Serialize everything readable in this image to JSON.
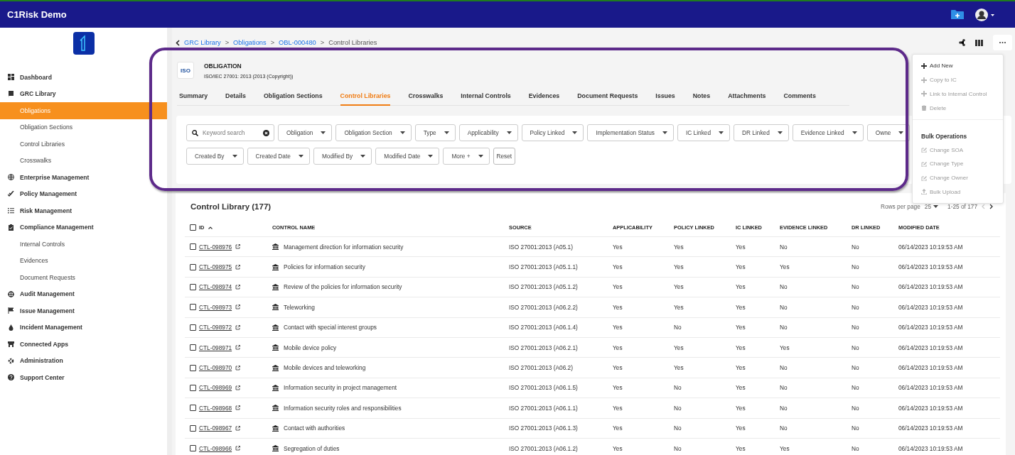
{
  "top_bar": {
    "title": "C1Risk Demo"
  },
  "sidebar": {
    "items": [
      {
        "kind": "section",
        "label": "Dashboard",
        "selected": false
      },
      {
        "kind": "section",
        "label": "GRC Library",
        "selected": false
      },
      {
        "kind": "sub",
        "label": "Obligations",
        "selected": true
      },
      {
        "kind": "sub",
        "label": "Obligation Sections",
        "selected": false
      },
      {
        "kind": "sub",
        "label": "Control Libraries",
        "selected": false
      },
      {
        "kind": "sub",
        "label": "Crosswalks",
        "selected": false
      },
      {
        "kind": "section",
        "label": "Enterprise Management",
        "selected": false
      },
      {
        "kind": "section",
        "label": "Policy Management",
        "selected": false
      },
      {
        "kind": "section",
        "label": "Risk Management",
        "selected": false
      },
      {
        "kind": "section",
        "label": "Compliance Management",
        "selected": false
      },
      {
        "kind": "sub",
        "label": "Internal Controls",
        "selected": false
      },
      {
        "kind": "sub",
        "label": "Evidences",
        "selected": false
      },
      {
        "kind": "sub",
        "label": "Document Requests",
        "selected": false
      },
      {
        "kind": "section",
        "label": "Audit Management",
        "selected": false
      },
      {
        "kind": "section",
        "label": "Issue Management",
        "selected": false
      },
      {
        "kind": "section",
        "label": "Incident Management",
        "selected": false
      },
      {
        "kind": "section",
        "label": "Connected Apps",
        "selected": false
      },
      {
        "kind": "section",
        "label": "Administration",
        "selected": false
      },
      {
        "kind": "section",
        "label": "Support Center",
        "selected": false
      }
    ]
  },
  "breadcrumb": {
    "separator": ">",
    "items": [
      "GRC Library",
      "Obligations",
      "OBL-000480"
    ],
    "current": "Control Libraries"
  },
  "header": {
    "logo": "ISO",
    "title": "OBLIGATION",
    "subtitle": "ISO/IEC 27001: 2013 (2013 (Copyright))"
  },
  "tabs": [
    {
      "label": "Summary",
      "selected": false
    },
    {
      "label": "Details",
      "selected": false
    },
    {
      "label": "Obligation Sections",
      "selected": false
    },
    {
      "label": "Control Libraries",
      "selected": true
    },
    {
      "label": "Crosswalks",
      "selected": false
    },
    {
      "label": "Internal Controls",
      "selected": false
    },
    {
      "label": "Evidences",
      "selected": false
    },
    {
      "label": "Document Requests",
      "selected": false
    },
    {
      "label": "Issues",
      "selected": false
    },
    {
      "label": "Notes",
      "selected": false
    },
    {
      "label": "Attachments",
      "selected": false
    },
    {
      "label": "Comments",
      "selected": false
    }
  ],
  "filters": [
    [
      {
        "kind": "search",
        "placeholder": "Keyword search"
      },
      {
        "kind": "dropdown",
        "label": "Obligation"
      },
      {
        "kind": "dropdown",
        "label": "Obligation Section"
      },
      {
        "kind": "dropdown",
        "label": "Type"
      },
      {
        "kind": "dropdown",
        "label": "Applicability"
      },
      {
        "kind": "dropdown",
        "label": "Policy Linked"
      },
      {
        "kind": "dropdown",
        "label": "Implementation Status"
      },
      {
        "kind": "dropdown",
        "label": "IC Linked"
      },
      {
        "kind": "dropdown",
        "label": "DR Linked"
      },
      {
        "kind": "dropdown",
        "label": "Evidence Linked"
      },
      {
        "kind": "dropdown",
        "label": "Owne"
      }
    ],
    [
      {
        "kind": "dropdown",
        "label": "Created By"
      },
      {
        "kind": "dropdown",
        "label": "Created Date"
      },
      {
        "kind": "dropdown",
        "label": "Modified By"
      },
      {
        "kind": "dropdown",
        "label": "Modified Date"
      },
      {
        "kind": "dropdown",
        "label": "More +"
      },
      {
        "kind": "button",
        "label": "Reset"
      }
    ]
  ],
  "action_menu": {
    "items": [
      {
        "kind": "action",
        "label": "Add New",
        "disabled": false
      },
      {
        "kind": "action",
        "label": "Copy to IC",
        "disabled": true
      },
      {
        "kind": "action",
        "label": "Link to Internal Control",
        "disabled": true
      },
      {
        "kind": "delete",
        "label": "Delete",
        "disabled": true
      },
      {
        "kind": "heading",
        "label": "Bulk Operations"
      },
      {
        "kind": "edit",
        "label": "Change SOA",
        "disabled": true
      },
      {
        "kind": "edit",
        "label": "Change Type",
        "disabled": true
      },
      {
        "kind": "edit",
        "label": "Change Owner",
        "disabled": true
      },
      {
        "kind": "upload",
        "label": "Bulk Upload",
        "disabled": true
      }
    ]
  },
  "annotation": {
    "kind": "outline"
  },
  "table": {
    "title": "Control Library (177)",
    "rows_per_page_label": "Rows per page",
    "rows_per_page": "25",
    "range": "1-25 of 177",
    "all_checked": false,
    "columns": [
      "ID",
      "CONTROL NAME",
      "SOURCE",
      "APPLICABILITY",
      "POLICY LINKED",
      "IC LINKED",
      "EVIDENCE LINKED",
      "DR LINKED",
      "MODIFIED DATE"
    ],
    "rows": [
      {
        "checked": false,
        "cells": [
          "CTL-098976",
          "Management direction for information security",
          "ISO 27001:2013 (A05.1)",
          "Yes",
          "Yes",
          "Yes",
          "No",
          "No",
          "06/14/2023 10:19:53 AM"
        ]
      },
      {
        "checked": false,
        "cells": [
          "CTL-098975",
          "Policies for information security",
          "ISO 27001:2013 (A05.1.1)",
          "Yes",
          "Yes",
          "Yes",
          "Yes",
          "No",
          "06/14/2023 10:19:53 AM"
        ]
      },
      {
        "checked": false,
        "cells": [
          "CTL-098974",
          "Review of the policies for information security",
          "ISO 27001:2013 (A05.1.2)",
          "Yes",
          "Yes",
          "Yes",
          "No",
          "No",
          "06/14/2023 10:19:53 AM"
        ]
      },
      {
        "checked": false,
        "cells": [
          "CTL-098973",
          "Teleworking",
          "ISO 27001:2013 (A06.2.2)",
          "Yes",
          "Yes",
          "Yes",
          "No",
          "No",
          "06/14/2023 10:19:53 AM"
        ]
      },
      {
        "checked": false,
        "cells": [
          "CTL-098972",
          "Contact with special interest groups",
          "ISO 27001:2013 (A06.1.4)",
          "Yes",
          "No",
          "Yes",
          "No",
          "No",
          "06/14/2023 10:19:53 AM"
        ]
      },
      {
        "checked": false,
        "cells": [
          "CTL-098971",
          "Mobile device policy",
          "ISO 27001:2013 (A06.2.1)",
          "Yes",
          "Yes",
          "Yes",
          "Yes",
          "No",
          "06/14/2023 10:19:53 AM"
        ]
      },
      {
        "checked": false,
        "cells": [
          "CTL-098970",
          "Mobile devices and teleworking",
          "ISO 27001:2013 (A06.2)",
          "Yes",
          "Yes",
          "Yes",
          "No",
          "No",
          "06/14/2023 10:19:53 AM"
        ]
      },
      {
        "checked": false,
        "cells": [
          "CTL-098969",
          "Information security in project management",
          "ISO 27001:2013 (A06.1.5)",
          "Yes",
          "No",
          "Yes",
          "No",
          "No",
          "06/14/2023 10:19:53 AM"
        ]
      },
      {
        "checked": false,
        "cells": [
          "CTL-098968",
          "Information security roles and responsibilities",
          "ISO 27001:2013 (A06.1.1)",
          "Yes",
          "No",
          "Yes",
          "No",
          "No",
          "06/14/2023 10:19:53 AM"
        ]
      },
      {
        "checked": false,
        "cells": [
          "CTL-098967",
          "Contact with authorities",
          "ISO 27001:2013 (A06.1.3)",
          "Yes",
          "No",
          "Yes",
          "No",
          "No",
          "06/14/2023 10:19:53 AM"
        ]
      },
      {
        "checked": false,
        "cells": [
          "CTL-098966",
          "Segregation of duties",
          "ISO 27001:2013 (A06.1.2)",
          "Yes",
          "No",
          "Yes",
          "Yes",
          "No",
          "06/14/2023 10:19:53 AM"
        ]
      }
    ]
  }
}
